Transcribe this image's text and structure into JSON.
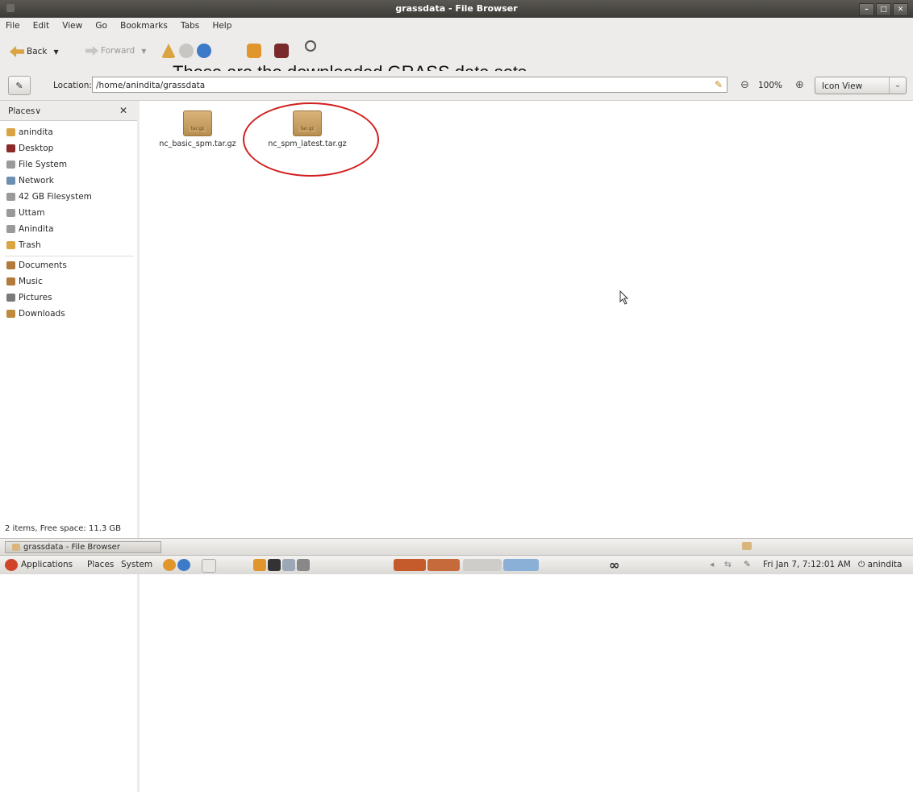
{
  "window": {
    "title": "grassdata - File Browser"
  },
  "menu": [
    "File",
    "Edit",
    "View",
    "Go",
    "Bookmarks",
    "Tabs",
    "Help"
  ],
  "toolbar": {
    "back": "Back",
    "forward": "Forward"
  },
  "annotation": "These are the downloaded GRASS data sets.",
  "location": {
    "label": "Location:",
    "path": "/home/anindita/grassdata",
    "zoom": "100%",
    "view": "Icon View"
  },
  "sidebar": {
    "header": "Places",
    "items": [
      {
        "label": "anindita",
        "icon": "home-folder-icon",
        "color": "#d9a441"
      },
      {
        "label": "Desktop",
        "icon": "desktop-icon",
        "color": "#8a2a2a"
      },
      {
        "label": "File System",
        "icon": "drive-icon",
        "color": "#9a9a9a"
      },
      {
        "label": "Network",
        "icon": "network-icon",
        "color": "#6f8fb0"
      },
      {
        "label": "42 GB Filesystem",
        "icon": "drive-icon",
        "color": "#9a9a9a"
      },
      {
        "label": "Uttam",
        "icon": "drive-icon",
        "color": "#9a9a9a"
      },
      {
        "label": "Anindita",
        "icon": "drive-icon",
        "color": "#9a9a9a"
      },
      {
        "label": "Trash",
        "icon": "trash-icon",
        "color": "#d9a441"
      },
      {
        "label": "Documents",
        "icon": "documents-folder-icon",
        "color": "#b27a3c"
      },
      {
        "label": "Music",
        "icon": "music-folder-icon",
        "color": "#b27a3c"
      },
      {
        "label": "Pictures",
        "icon": "pictures-folder-icon",
        "color": "#7a7a7a"
      },
      {
        "label": "Downloads",
        "icon": "downloads-folder-icon",
        "color": "#c08a3c"
      }
    ]
  },
  "files": [
    {
      "name": "nc_basic_spm.tar.gz",
      "tag": "tar.gz"
    },
    {
      "name": "nc_spm_latest.tar.gz",
      "tag": "tar.gz"
    }
  ],
  "status": "2 items, Free space: 11.3 GB",
  "taskbar": {
    "window_button": "grassdata - File Browser"
  },
  "panel": {
    "menus": [
      "Applications",
      "Places",
      "System"
    ],
    "clock": "Fri Jan 7, 7:12:01 AM",
    "user": "anindita"
  }
}
